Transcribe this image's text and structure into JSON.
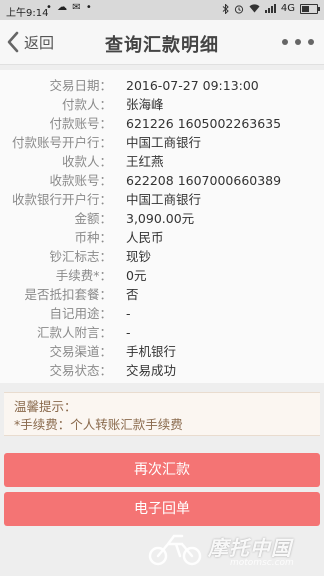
{
  "status_bar": {
    "time": "上午9:14",
    "indicators": "• ☁ ✉ •",
    "network": "4G",
    "icons": [
      "bluetooth-icon",
      "alarm-icon",
      "wifi-icon",
      "signal-icon",
      "battery-icon"
    ]
  },
  "header": {
    "back_label": "返回",
    "title": "查询汇款明细"
  },
  "details": [
    {
      "label": "交易日期：",
      "value": "2016-07-27 09:13:00"
    },
    {
      "label": "付款人：",
      "value": "张海峰"
    },
    {
      "label": "付款账号：",
      "value": "621226 1605002263635"
    },
    {
      "label": "付款账号开户行：",
      "value": "中国工商银行"
    },
    {
      "label": "收款人：",
      "value": "王红燕"
    },
    {
      "label": "收款账号：",
      "value": "622208 1607000660389"
    },
    {
      "label": "收款银行开户行：",
      "value": "中国工商银行"
    },
    {
      "label": "金额：",
      "value": "3,090.00元"
    },
    {
      "label": "币种：",
      "value": "人民币"
    },
    {
      "label": "钞汇标志：",
      "value": "现钞"
    },
    {
      "label": "手续费*：",
      "value": "0元"
    },
    {
      "label": "是否抵扣套餐：",
      "value": "否"
    },
    {
      "label": "自记用途：",
      "value": "-"
    },
    {
      "label": "汇款人附言：",
      "value": "-"
    },
    {
      "label": "交易渠道：",
      "value": "手机银行"
    },
    {
      "label": "交易状态：",
      "value": "交易成功"
    }
  ],
  "tip": {
    "title": "温馨提示：",
    "text": "*手续费：个人转账汇款手续费"
  },
  "buttons": {
    "resend": "再次汇款",
    "receipt": "电子回单"
  },
  "watermark": {
    "cn": "摩托中国",
    "en": "motomsc.com"
  },
  "colors": {
    "button": "#f47474",
    "label": "#8a8a8a",
    "tip_text": "#8a6a4d"
  }
}
